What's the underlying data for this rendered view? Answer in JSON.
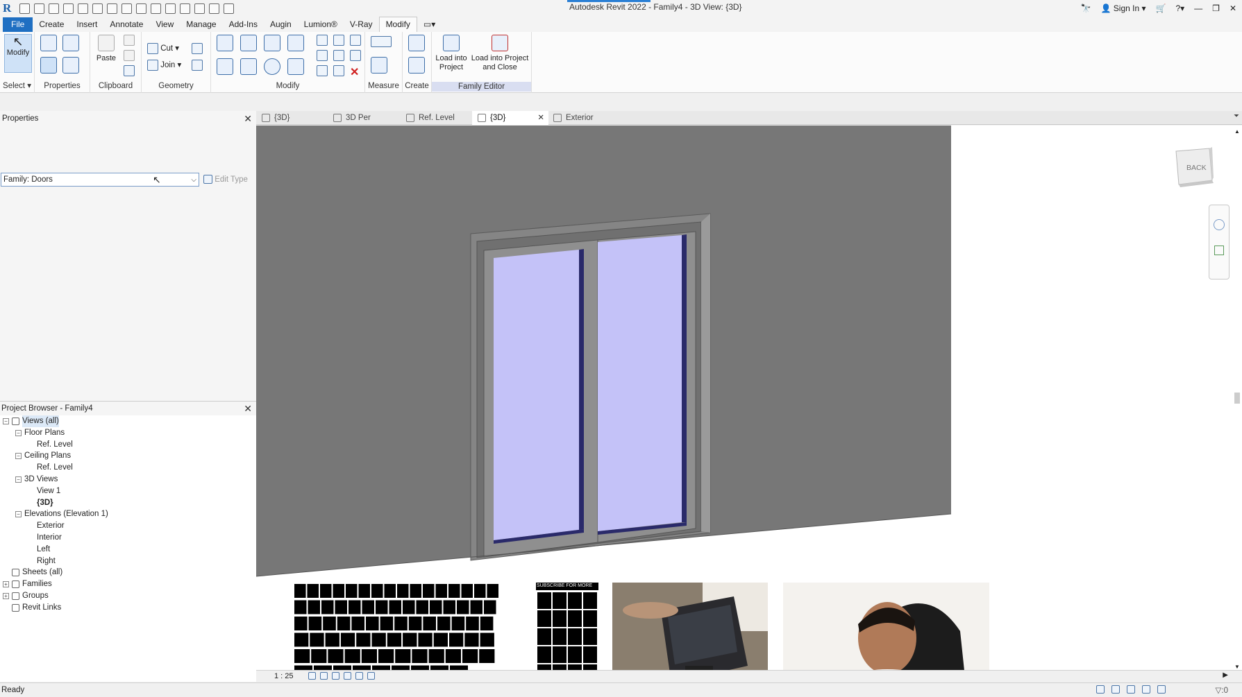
{
  "window": {
    "title": "Autodesk Revit 2022 - Family4 - 3D View: {3D}",
    "sign_in": "Sign In",
    "app_logo": "R"
  },
  "menu": {
    "tabs": [
      "File",
      "Create",
      "Insert",
      "Annotate",
      "View",
      "Manage",
      "Add-Ins",
      "Augin",
      "Lumion®",
      "V-Ray",
      "Modify"
    ],
    "active": "Modify"
  },
  "ribbon": {
    "select_panel": {
      "button": "Modify",
      "label": "Select"
    },
    "properties_panel": {
      "label": "Properties"
    },
    "clipboard_panel": {
      "paste": "Paste",
      "label": "Clipboard"
    },
    "geometry_panel": {
      "cut": "Cut",
      "join": "Join",
      "label": "Geometry"
    },
    "modify_panel": {
      "label": "Modify"
    },
    "measure_panel": {
      "label": "Measure"
    },
    "create_panel": {
      "label": "Create"
    },
    "family_editor_panel": {
      "load_into_project": "Load into Project",
      "load_into_project_close": "Load into Project and Close",
      "label": "Family Editor"
    }
  },
  "properties": {
    "title": "Properties",
    "type_selector": "Family: Doors",
    "edit_type": "Edit Type"
  },
  "browser": {
    "title": "Project Browser - Family4",
    "tree": [
      {
        "label": "Views (all)",
        "level": 0,
        "toggle": "-"
      },
      {
        "label": "Floor Plans",
        "level": 1,
        "toggle": "-"
      },
      {
        "label": "Ref. Level",
        "level": 2,
        "toggle": ""
      },
      {
        "label": "Ceiling Plans",
        "level": 1,
        "toggle": "-"
      },
      {
        "label": "Ref. Level",
        "level": 2,
        "toggle": ""
      },
      {
        "label": "3D Views",
        "level": 1,
        "toggle": "-"
      },
      {
        "label": "View 1",
        "level": 2,
        "toggle": ""
      },
      {
        "label": "{3D}",
        "level": 2,
        "toggle": ""
      },
      {
        "label": "Elevations (Elevation 1)",
        "level": 1,
        "toggle": "-"
      },
      {
        "label": "Exterior",
        "level": 2,
        "toggle": ""
      },
      {
        "label": "Interior",
        "level": 2,
        "toggle": ""
      },
      {
        "label": "Left",
        "level": 2,
        "toggle": ""
      },
      {
        "label": "Right",
        "level": 2,
        "toggle": ""
      },
      {
        "label": "Sheets (all)",
        "level": 0,
        "toggle": ""
      },
      {
        "label": "Families",
        "level": 0,
        "toggle": "+"
      },
      {
        "label": "Groups",
        "level": 0,
        "toggle": "+"
      },
      {
        "label": "Revit Links",
        "level": 0,
        "toggle": ""
      }
    ]
  },
  "view_tabs": [
    {
      "label": "{3D}"
    },
    {
      "label": "3D Per"
    },
    {
      "label": "Ref. Level"
    },
    {
      "label": "{3D}",
      "active": true
    },
    {
      "label": "Exterior"
    }
  ],
  "viewcube": {
    "face": "BACK"
  },
  "view_control": {
    "scale": "1 : 25"
  },
  "status": {
    "text": "Ready",
    "filter": ":0"
  },
  "keyboard_overlay": {
    "banner": "SUBSCRIBE FOR MORE"
  },
  "colors": {
    "wall": "#777777",
    "frame": "#8a8a8a",
    "glass": "#c4c2f8",
    "accent": "#1f6fc2",
    "family_editor_bg": "#d9def1"
  }
}
